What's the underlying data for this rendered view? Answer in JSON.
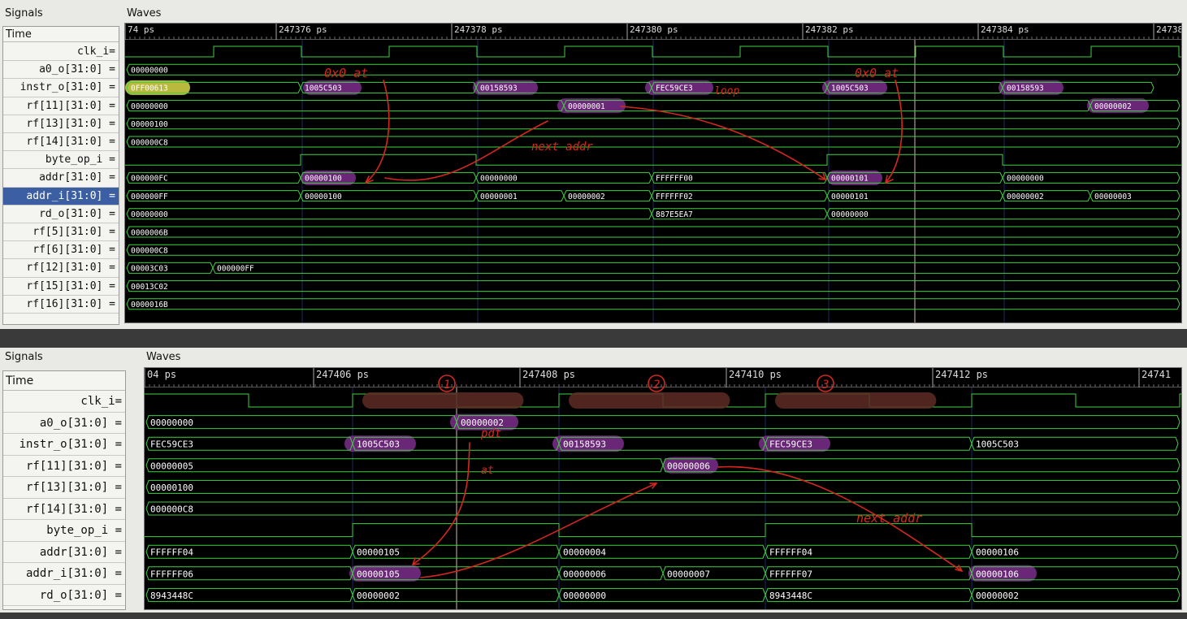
{
  "top": {
    "signals_title": "Signals",
    "waves_title": "Waves",
    "time_label": "Time",
    "time_ticks": [
      "74 ps",
      "247376 ps",
      "247378 ps",
      "247380 ps",
      "247382 ps",
      "247384 ps",
      "24738"
    ],
    "signals": [
      {
        "label": "clk_i=",
        "selected": false
      },
      {
        "label": "a0_o[31:0] =",
        "selected": false
      },
      {
        "label": "instr_o[31:0] =",
        "selected": false
      },
      {
        "label": "rf[11][31:0] =",
        "selected": false
      },
      {
        "label": "rf[13][31:0] =",
        "selected": false
      },
      {
        "label": "rf[14][31:0] =",
        "selected": false
      },
      {
        "label": "byte_op_i =",
        "selected": false
      },
      {
        "label": "addr[31:0] =",
        "selected": false
      },
      {
        "label": "addr_i[31:0] =",
        "selected": true
      },
      {
        "label": "rd_o[31:0] =",
        "selected": false
      },
      {
        "label": "rf[5][31:0] =",
        "selected": false
      },
      {
        "label": "rf[6][31:0] =",
        "selected": false
      },
      {
        "label": "rf[12][31:0] =",
        "selected": false
      },
      {
        "label": "rf[15][31:0] =",
        "selected": false
      },
      {
        "label": "rf[16][31:0] =",
        "selected": false
      }
    ],
    "values": {
      "a0_o": [
        "00000000"
      ],
      "instr_o": [
        "0FF00613",
        "1005C503",
        "00158593",
        "FEC59CE3",
        "1005C503",
        "00158593"
      ],
      "rf11": [
        "00000000",
        "00000001",
        "00000002"
      ],
      "rf13": [
        "00000100"
      ],
      "rf14": [
        "000000C8"
      ],
      "addr": [
        "000000FC",
        "00000100",
        "00000000",
        "FFFFFF00",
        "00000101",
        "00000000"
      ],
      "addr_i": [
        "000000FF",
        "00000100",
        "00000001",
        "00000002",
        "FFFFFF02",
        "00000101",
        "00000002",
        "00000003"
      ],
      "rd_o": [
        "00000000",
        "887E5EA7",
        "00000000"
      ],
      "rf5": [
        "0000006B"
      ],
      "rf6": [
        "000000C8"
      ],
      "rf12": [
        "00003C03",
        "000000FF"
      ],
      "rf15": [
        "00013C02"
      ],
      "rf16": [
        "0000016B"
      ]
    },
    "annotations": [
      "0x0 at",
      "0x0 at",
      "loop",
      "next addr"
    ]
  },
  "bottom": {
    "signals_title": "Signals",
    "waves_title": "Waves",
    "time_label": "Time",
    "time_ticks": [
      "04 ps",
      "247406 ps",
      "247408 ps",
      "247410 ps",
      "247412 ps",
      "24741"
    ],
    "signals": [
      {
        "label": "clk_i=",
        "selected": false
      },
      {
        "label": "a0_o[31:0] =",
        "selected": false
      },
      {
        "label": "instr_o[31:0] =",
        "selected": false
      },
      {
        "label": "rf[11][31:0] =",
        "selected": false
      },
      {
        "label": "rf[13][31:0] =",
        "selected": false
      },
      {
        "label": "rf[14][31:0] =",
        "selected": false
      },
      {
        "label": "byte_op_i =",
        "selected": false
      },
      {
        "label": "addr[31:0] =",
        "selected": false
      },
      {
        "label": "addr_i[31:0] =",
        "selected": false
      },
      {
        "label": "rd_o[31:0] =",
        "selected": false
      }
    ],
    "values": {
      "a0_o": [
        "00000000",
        "00000002"
      ],
      "instr_o": [
        "FEC59CE3",
        "1005C503",
        "00158593",
        "FEC59CE3",
        "1005C503"
      ],
      "rf11": [
        "00000005",
        "00000006"
      ],
      "rf13": [
        "00000100"
      ],
      "rf14": [
        "000000C8"
      ],
      "addr": [
        "FFFFFF04",
        "00000105",
        "00000004",
        "FFFFFF04",
        "00000106"
      ],
      "addr_i": [
        "FFFFFF06",
        "00000105",
        "00000006",
        "00000007",
        "FFFFFF07",
        "00000106"
      ],
      "rd_o": [
        "8943448C",
        "00000002",
        "00000000",
        "8943448C",
        "00000002"
      ]
    },
    "annotations": [
      "1",
      "2",
      "3",
      "pdt",
      "at",
      "next addr"
    ]
  },
  "colors": {
    "wave": "#3fd13f",
    "highlight": "#7d2d8c",
    "yellow": "#d9d94a",
    "ink": "#d4281e",
    "cursor": "#d9b6b0",
    "selected": "#3c5fa3"
  }
}
